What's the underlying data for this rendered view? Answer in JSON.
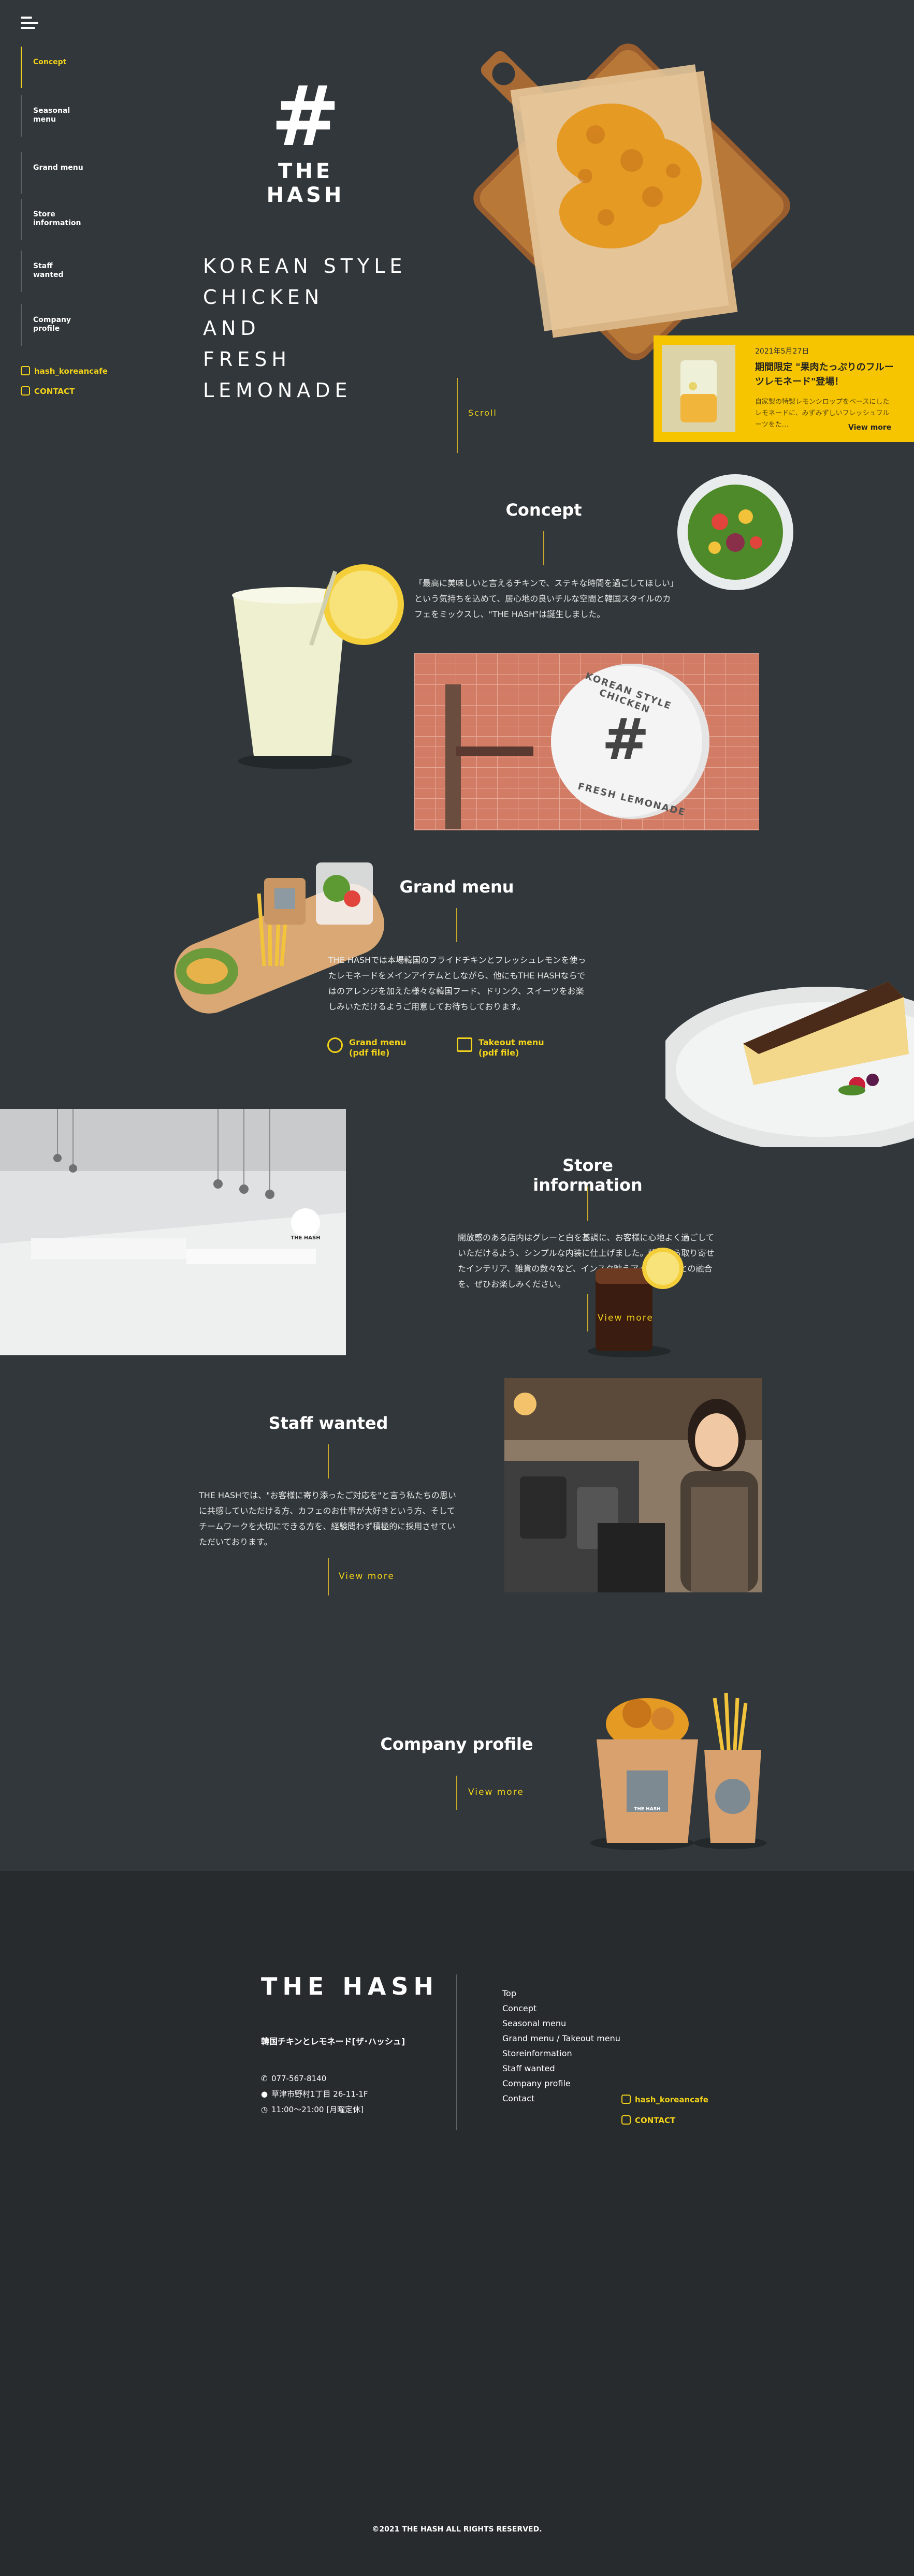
{
  "brand": {
    "logo_text": "THE HASH",
    "logo_footer": "THE HASH"
  },
  "nav": {
    "items": [
      {
        "label": "Concept"
      },
      {
        "label": "Seasonal menu"
      },
      {
        "label": "Grand menu"
      },
      {
        "label": "Store information"
      },
      {
        "label": "Staff wanted"
      },
      {
        "label": "Company profile"
      }
    ],
    "instagram": "hash_koreancafe",
    "contact": "CONTACT"
  },
  "hero": {
    "lines": [
      "KOREAN STYLE",
      "CHICKEN",
      "AND",
      "FRESH",
      "LEMONADE"
    ],
    "scroll_label": "Scroll"
  },
  "news": {
    "date": "2021年5月27日",
    "title": "期間限定 \"果肉たっぷりのフルーツレモネード\"登場！",
    "excerpt": "自家製の特製レモンシロップをベースにしたレモネードに、みずみずしいフレッシュフルーツをた…",
    "more": "View more"
  },
  "concept": {
    "title": "Concept",
    "text": "「最高に美味しいと言えるチキンで、ステキな時間を過ごしてほしい」という気持ちを込めて、居心地の良いチルな空間と韓国スタイルのカフェをミックスし、\"THE HASH\"は誕生しました。",
    "sign_top": "KOREAN STYLE CHICKEN",
    "sign_bottom": "FRESH LEMONADE"
  },
  "grand": {
    "title": "Grand menu",
    "text": "THE HASHでは本場韓国のフライドチキンとフレッシュレモンを使ったレモネードをメインアイテムとしながら、他にもTHE HASHならではのアレンジを加えた様々な韓国フード、ドリンク、スイーツをお楽しみいただけるようご用意してお待ちしております。",
    "link1_line1": "Grand menu",
    "link1_line2": "(pdf file)",
    "link2_line1": "Takeout menu",
    "link2_line2": "(pdf file)"
  },
  "store": {
    "title": "Store information",
    "text": "開放感のある店内はグレーと白を基調に、お客様に心地よく過ごしていただけるよう、シンプルな内装に仕上げました。韓国から取り寄せたインテリア、雑貨の数々など、インスタ映えアイテムなどとの融合を、ぜひお楽しみください。",
    "more": "View more",
    "sign_text": "THE HASH"
  },
  "staff": {
    "title": "Staff wanted",
    "text": "THE HASHでは、\"お客様に寄り添ったご対応を\"と言う私たちの思いに共感していただける方、カフェのお仕事が大好きという方、そしてチームワークを大切にできる方を、経験問わず積極的に採用させていただいております。",
    "more": "View more"
  },
  "company": {
    "title": "Company profile",
    "more": "View more",
    "cup_text": "THE HASH"
  },
  "footer": {
    "shop_name": "韓国チキンとレモネード[ザ･ハッシュ]",
    "phone": "077-567-8140",
    "address": "草津市野村1丁目 26-11-1F",
    "hours": "11:00〜21:00 [月曜定休]",
    "links": [
      "Top",
      "Concept",
      "Seasonal menu",
      "Grand menu / Takeout menu",
      "Storeinformation",
      "Staff wanted",
      "Company profile",
      "Contact"
    ],
    "instagram": "hash_koreancafe",
    "contact": "CONTACT",
    "copyright": "©2021 THE HASH ALL RIGHTS RESERVED."
  }
}
